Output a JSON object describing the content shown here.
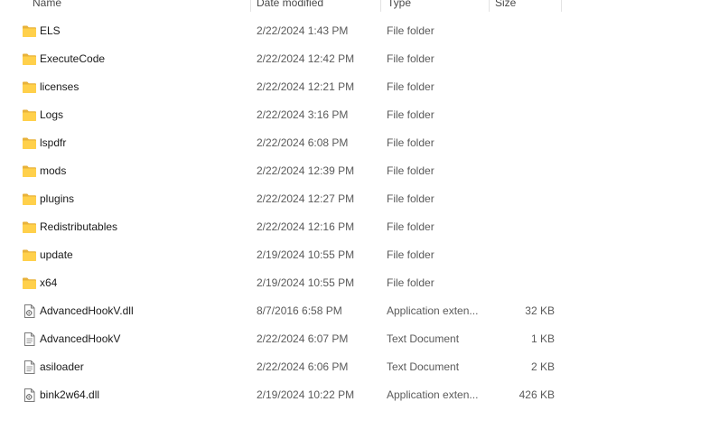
{
  "columns": {
    "name": "Name",
    "date_modified": "Date modified",
    "type": "Type",
    "size": "Size"
  },
  "files": [
    {
      "name": "ELS",
      "date": "2/22/2024 1:43 PM",
      "type": "File folder",
      "size": "",
      "icon": "folder-icon"
    },
    {
      "name": "ExecuteCode",
      "date": "2/22/2024 12:42 PM",
      "type": "File folder",
      "size": "",
      "icon": "folder-icon"
    },
    {
      "name": "licenses",
      "date": "2/22/2024 12:21 PM",
      "type": "File folder",
      "size": "",
      "icon": "folder-icon"
    },
    {
      "name": "Logs",
      "date": "2/22/2024 3:16 PM",
      "type": "File folder",
      "size": "",
      "icon": "folder-icon"
    },
    {
      "name": "lspdfr",
      "date": "2/22/2024 6:08 PM",
      "type": "File folder",
      "size": "",
      "icon": "folder-icon"
    },
    {
      "name": "mods",
      "date": "2/22/2024 12:39 PM",
      "type": "File folder",
      "size": "",
      "icon": "folder-icon"
    },
    {
      "name": "plugins",
      "date": "2/22/2024 12:27 PM",
      "type": "File folder",
      "size": "",
      "icon": "folder-icon"
    },
    {
      "name": "Redistributables",
      "date": "2/22/2024 12:16 PM",
      "type": "File folder",
      "size": "",
      "icon": "folder-icon"
    },
    {
      "name": "update",
      "date": "2/19/2024 10:55 PM",
      "type": "File folder",
      "size": "",
      "icon": "folder-icon"
    },
    {
      "name": "x64",
      "date": "2/19/2024 10:55 PM",
      "type": "File folder",
      "size": "",
      "icon": "folder-icon"
    },
    {
      "name": "AdvancedHookV.dll",
      "date": "8/7/2016 6:58 PM",
      "type": "Application exten...",
      "size": "32 KB",
      "icon": "dll-file-icon"
    },
    {
      "name": "AdvancedHookV",
      "date": "2/22/2024 6:07 PM",
      "type": "Text Document",
      "size": "1 KB",
      "icon": "text-file-icon"
    },
    {
      "name": "asiloader",
      "date": "2/22/2024 6:06 PM",
      "type": "Text Document",
      "size": "2 KB",
      "icon": "text-file-icon"
    },
    {
      "name": "bink2w64.dll",
      "date": "2/19/2024 10:22 PM",
      "type": "Application exten...",
      "size": "426 KB",
      "icon": "dll-file-icon"
    }
  ],
  "colors": {
    "folder_back": "#e8b23a",
    "folder_front": "#ffd04b",
    "file_border": "#7a7a7a",
    "column_separator": "#e3e3e3",
    "secondary_text": "#5a5a5a"
  }
}
